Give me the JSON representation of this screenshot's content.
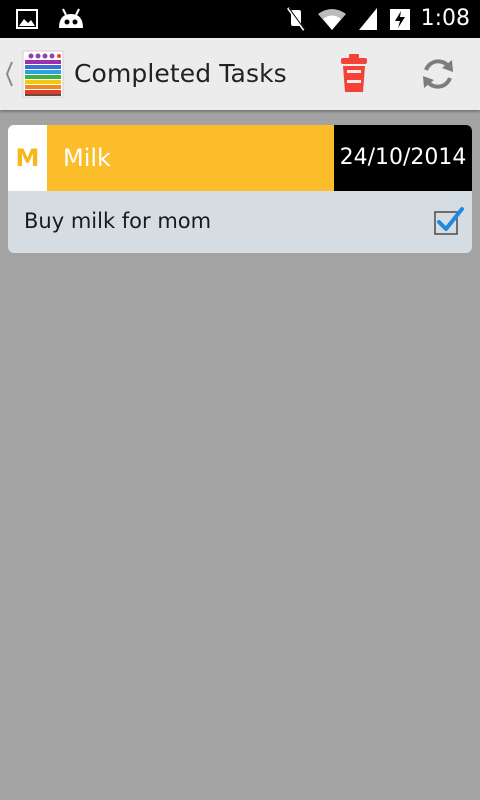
{
  "status_bar": {
    "time": "1:08",
    "icons": [
      "picture-icon",
      "android-notification-icon",
      "mute-icon",
      "wifi-icon",
      "signal-icon",
      "battery-charging-icon"
    ]
  },
  "action_bar": {
    "title": "Completed Tasks",
    "icons": [
      "back-chevron-icon",
      "app-logo",
      "trash-icon",
      "refresh-icon"
    ],
    "delete_color": "#f44336"
  },
  "tasks": [
    {
      "initial": "M",
      "name": "Milk",
      "date": "24/10/2014",
      "description": "Buy milk for mom",
      "completed": true,
      "color": "#fbbd2a"
    }
  ]
}
